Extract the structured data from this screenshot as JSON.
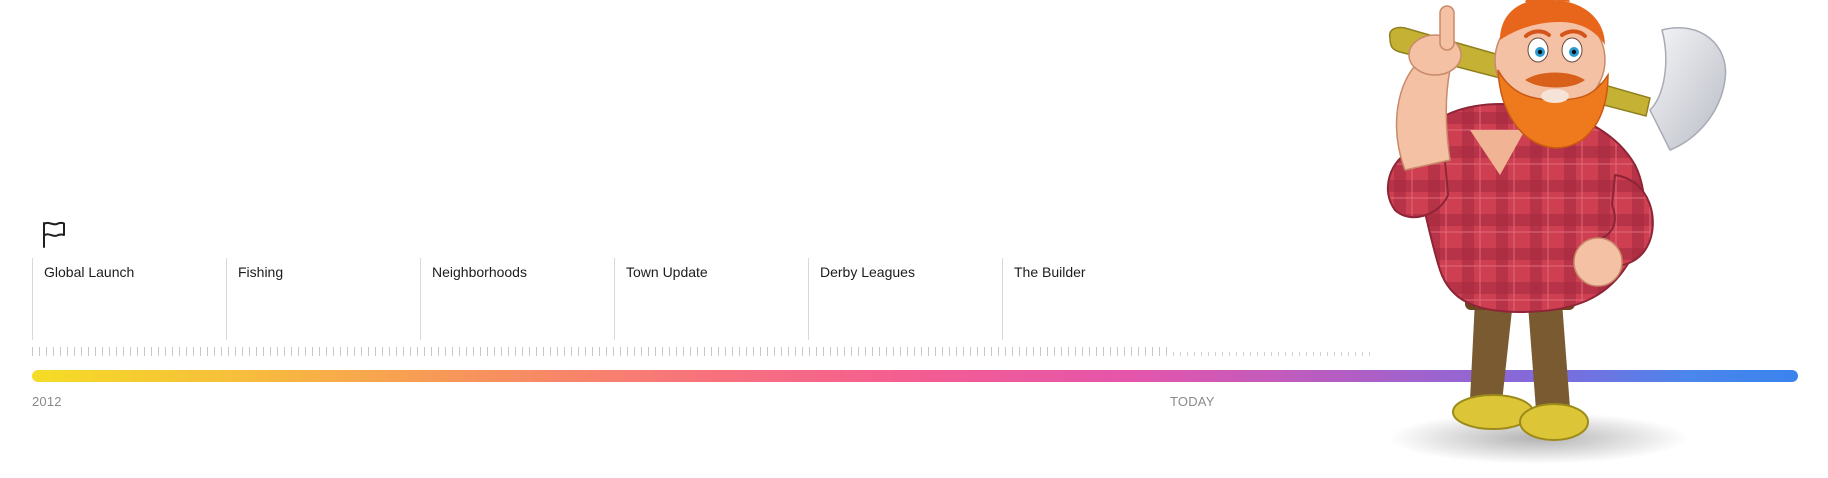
{
  "timeline": {
    "milestones": [
      {
        "label": "Global Launch"
      },
      {
        "label": "Fishing"
      },
      {
        "label": "Neighborhoods"
      },
      {
        "label": "Town Update"
      },
      {
        "label": "Derby Leagues"
      },
      {
        "label": "The Builder"
      }
    ],
    "start_label": "2012",
    "today_label": "TODAY"
  },
  "icons": {
    "flag": "flag-icon",
    "mascot": "lumberjack-mascot"
  },
  "colors": {
    "gradient": [
      "#f5dc25",
      "#f7935c",
      "#f35d92",
      "#b05ec6",
      "#3a83ee"
    ],
    "milestone_divider": "#d9d9d9",
    "axis_label": "#8a8a8a",
    "mascot_shirt": "#c8384a",
    "mascot_beard": "#ef7a1e"
  }
}
